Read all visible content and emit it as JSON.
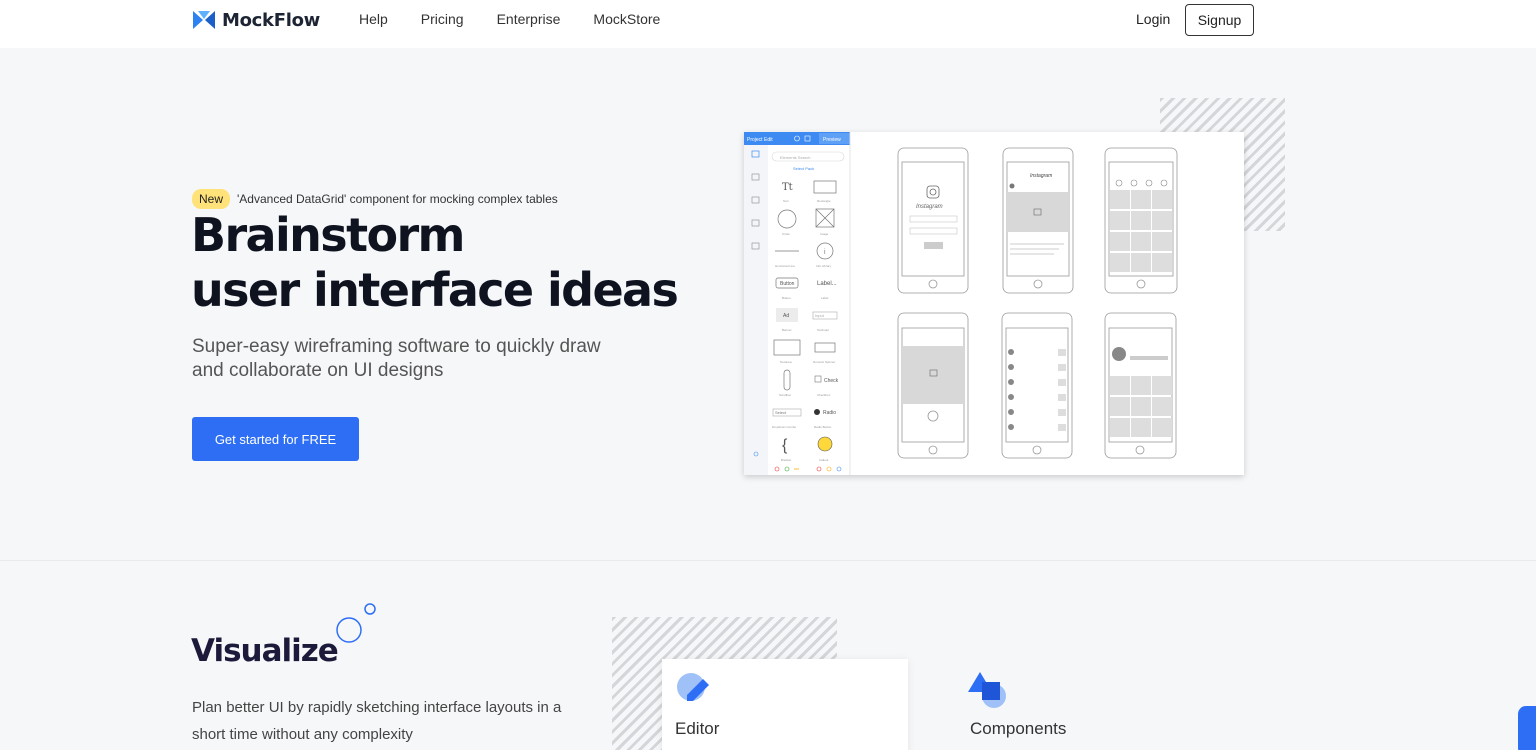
{
  "nav": {
    "logo": "MockFlow",
    "links": [
      "Help",
      "Pricing",
      "Enterprise",
      "MockStore"
    ],
    "login": "Login",
    "signup": "Signup"
  },
  "hero": {
    "badge": "New",
    "badge_text": "'Advanced DataGrid' component for mocking complex tables",
    "title_line1": "Brainstorm",
    "title_line2": "user interface ideas",
    "subtitle_line1": "Super-easy wireframing software to quickly draw",
    "subtitle_line2": "and collaborate on UI designs",
    "cta": "Get started for FREE"
  },
  "app_screenshot": {
    "toolbar": [
      "Project",
      "Edit"
    ],
    "preview": "Preview",
    "search_placeholder": "Elements Search",
    "select_pack": "Select Pack",
    "components": [
      "Text",
      "Rectangle",
      "Circle",
      "Image",
      "Horizontal Line",
      "Info Library",
      "Button",
      "Label",
      "Banner",
      "Textinput",
      "Textarea",
      "Numeric Spinner",
      "Scrollbar",
      "Checkbox",
      "Dropdown Combo",
      "Radio Button",
      "Bracket",
      "Callout"
    ],
    "button_text": "Button",
    "label_text": "Label...",
    "ad_text": "Ad",
    "input_text": "Input",
    "check_text": "Check",
    "radio_text": "Radio",
    "select_text": "Select",
    "instagram": "Instagram"
  },
  "section2": {
    "title": "Visualize",
    "desc": "Plan better UI by rapidly sketching interface layouts in a short time without any complexity",
    "card1": "Editor",
    "card2": "Components"
  },
  "colors": {
    "accent": "#2d6ef5",
    "badge": "#ffe27a",
    "title": "#0f1320"
  }
}
